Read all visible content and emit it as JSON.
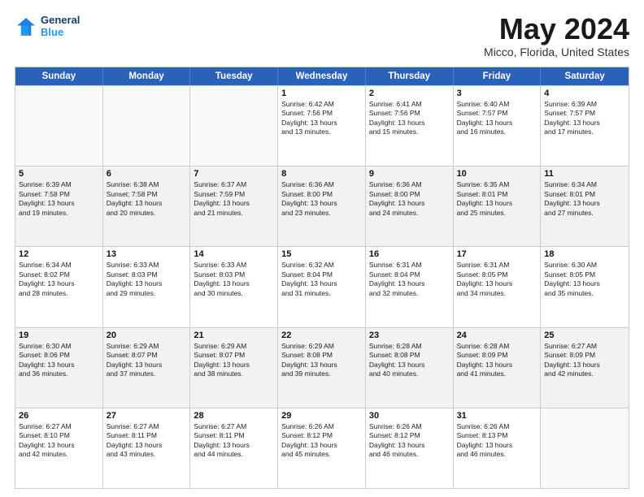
{
  "header": {
    "logo_general": "General",
    "logo_blue": "Blue",
    "month": "May 2024",
    "location": "Micco, Florida, United States"
  },
  "weekdays": [
    "Sunday",
    "Monday",
    "Tuesday",
    "Wednesday",
    "Thursday",
    "Friday",
    "Saturday"
  ],
  "rows": [
    [
      {
        "day": "",
        "info": ""
      },
      {
        "day": "",
        "info": ""
      },
      {
        "day": "",
        "info": ""
      },
      {
        "day": "1",
        "info": "Sunrise: 6:42 AM\nSunset: 7:56 PM\nDaylight: 13 hours\nand 13 minutes."
      },
      {
        "day": "2",
        "info": "Sunrise: 6:41 AM\nSunset: 7:56 PM\nDaylight: 13 hours\nand 15 minutes."
      },
      {
        "day": "3",
        "info": "Sunrise: 6:40 AM\nSunset: 7:57 PM\nDaylight: 13 hours\nand 16 minutes."
      },
      {
        "day": "4",
        "info": "Sunrise: 6:39 AM\nSunset: 7:57 PM\nDaylight: 13 hours\nand 17 minutes."
      }
    ],
    [
      {
        "day": "5",
        "info": "Sunrise: 6:39 AM\nSunset: 7:58 PM\nDaylight: 13 hours\nand 19 minutes."
      },
      {
        "day": "6",
        "info": "Sunrise: 6:38 AM\nSunset: 7:58 PM\nDaylight: 13 hours\nand 20 minutes."
      },
      {
        "day": "7",
        "info": "Sunrise: 6:37 AM\nSunset: 7:59 PM\nDaylight: 13 hours\nand 21 minutes."
      },
      {
        "day": "8",
        "info": "Sunrise: 6:36 AM\nSunset: 8:00 PM\nDaylight: 13 hours\nand 23 minutes."
      },
      {
        "day": "9",
        "info": "Sunrise: 6:36 AM\nSunset: 8:00 PM\nDaylight: 13 hours\nand 24 minutes."
      },
      {
        "day": "10",
        "info": "Sunrise: 6:35 AM\nSunset: 8:01 PM\nDaylight: 13 hours\nand 25 minutes."
      },
      {
        "day": "11",
        "info": "Sunrise: 6:34 AM\nSunset: 8:01 PM\nDaylight: 13 hours\nand 27 minutes."
      }
    ],
    [
      {
        "day": "12",
        "info": "Sunrise: 6:34 AM\nSunset: 8:02 PM\nDaylight: 13 hours\nand 28 minutes."
      },
      {
        "day": "13",
        "info": "Sunrise: 6:33 AM\nSunset: 8:03 PM\nDaylight: 13 hours\nand 29 minutes."
      },
      {
        "day": "14",
        "info": "Sunrise: 6:33 AM\nSunset: 8:03 PM\nDaylight: 13 hours\nand 30 minutes."
      },
      {
        "day": "15",
        "info": "Sunrise: 6:32 AM\nSunset: 8:04 PM\nDaylight: 13 hours\nand 31 minutes."
      },
      {
        "day": "16",
        "info": "Sunrise: 6:31 AM\nSunset: 8:04 PM\nDaylight: 13 hours\nand 32 minutes."
      },
      {
        "day": "17",
        "info": "Sunrise: 6:31 AM\nSunset: 8:05 PM\nDaylight: 13 hours\nand 34 minutes."
      },
      {
        "day": "18",
        "info": "Sunrise: 6:30 AM\nSunset: 8:05 PM\nDaylight: 13 hours\nand 35 minutes."
      }
    ],
    [
      {
        "day": "19",
        "info": "Sunrise: 6:30 AM\nSunset: 8:06 PM\nDaylight: 13 hours\nand 36 minutes."
      },
      {
        "day": "20",
        "info": "Sunrise: 6:29 AM\nSunset: 8:07 PM\nDaylight: 13 hours\nand 37 minutes."
      },
      {
        "day": "21",
        "info": "Sunrise: 6:29 AM\nSunset: 8:07 PM\nDaylight: 13 hours\nand 38 minutes."
      },
      {
        "day": "22",
        "info": "Sunrise: 6:29 AM\nSunset: 8:08 PM\nDaylight: 13 hours\nand 39 minutes."
      },
      {
        "day": "23",
        "info": "Sunrise: 6:28 AM\nSunset: 8:08 PM\nDaylight: 13 hours\nand 40 minutes."
      },
      {
        "day": "24",
        "info": "Sunrise: 6:28 AM\nSunset: 8:09 PM\nDaylight: 13 hours\nand 41 minutes."
      },
      {
        "day": "25",
        "info": "Sunrise: 6:27 AM\nSunset: 8:09 PM\nDaylight: 13 hours\nand 42 minutes."
      }
    ],
    [
      {
        "day": "26",
        "info": "Sunrise: 6:27 AM\nSunset: 8:10 PM\nDaylight: 13 hours\nand 42 minutes."
      },
      {
        "day": "27",
        "info": "Sunrise: 6:27 AM\nSunset: 8:11 PM\nDaylight: 13 hours\nand 43 minutes."
      },
      {
        "day": "28",
        "info": "Sunrise: 6:27 AM\nSunset: 8:11 PM\nDaylight: 13 hours\nand 44 minutes."
      },
      {
        "day": "29",
        "info": "Sunrise: 6:26 AM\nSunset: 8:12 PM\nDaylight: 13 hours\nand 45 minutes."
      },
      {
        "day": "30",
        "info": "Sunrise: 6:26 AM\nSunset: 8:12 PM\nDaylight: 13 hours\nand 46 minutes."
      },
      {
        "day": "31",
        "info": "Sunrise: 6:26 AM\nSunset: 8:13 PM\nDaylight: 13 hours\nand 46 minutes."
      },
      {
        "day": "",
        "info": ""
      }
    ]
  ]
}
